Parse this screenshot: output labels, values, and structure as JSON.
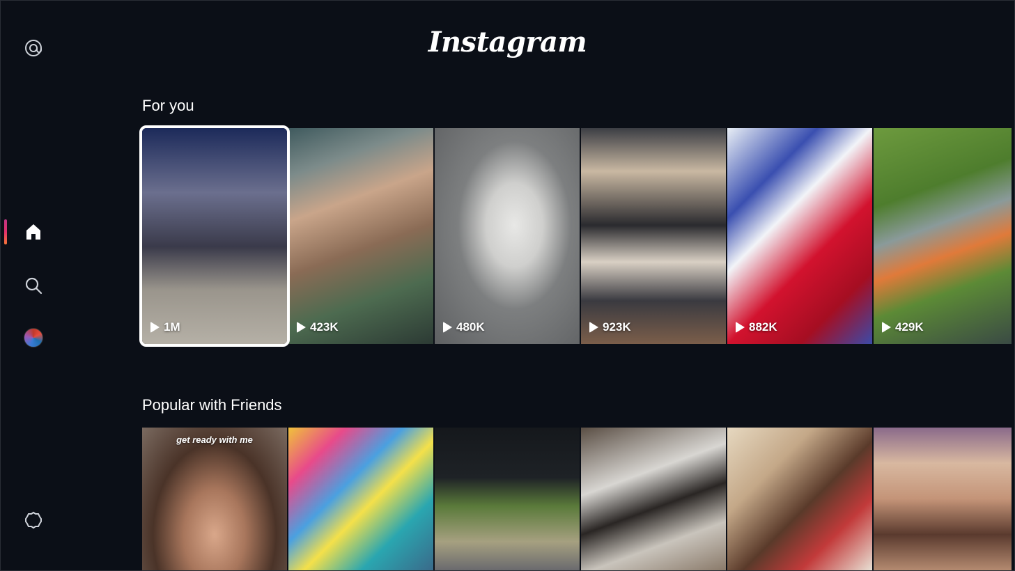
{
  "app": {
    "logo": "Instagram"
  },
  "sidebar": {
    "items": [
      {
        "name": "threads",
        "icon": "threads-icon"
      },
      {
        "name": "home",
        "icon": "home-icon",
        "active": true
      },
      {
        "name": "search",
        "icon": "search-icon"
      },
      {
        "name": "profile",
        "icon": "avatar"
      },
      {
        "name": "settings",
        "icon": "gear-icon"
      }
    ]
  },
  "sections": [
    {
      "title": "For you",
      "tiles": [
        {
          "count": "1M",
          "focused": true
        },
        {
          "count": "423K"
        },
        {
          "count": "480K"
        },
        {
          "count": "923K"
        },
        {
          "count": "882K"
        },
        {
          "count": "429K"
        }
      ]
    },
    {
      "title": "Popular with Friends",
      "tiles": [
        {
          "caption": "get ready with me"
        },
        {},
        {},
        {},
        {},
        {}
      ]
    }
  ],
  "colors": {
    "background": "#0b0f17",
    "accent_start": "#c13584",
    "accent_end": "#f77737"
  }
}
